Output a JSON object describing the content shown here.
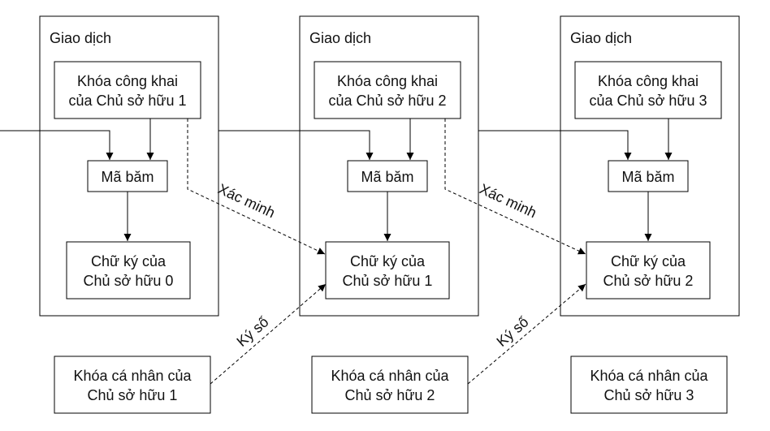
{
  "transactions": [
    {
      "title": "Giao dịch",
      "public_key": [
        "Khóa công khai",
        "của Chủ sở hữu 1"
      ],
      "hash": "Mã băm",
      "signature": [
        "Chữ ký của",
        "Chủ sở hữu 0"
      ]
    },
    {
      "title": "Giao dịch",
      "public_key": [
        "Khóa công khai",
        "của Chủ sở hữu 2"
      ],
      "hash": "Mã băm",
      "signature": [
        "Chữ ký của",
        "Chủ sở hữu 1"
      ]
    },
    {
      "title": "Giao dịch",
      "public_key": [
        "Khóa công khai",
        "của Chủ sở hữu 3"
      ],
      "hash": "Mã băm",
      "signature": [
        "Chữ ký của",
        "Chủ sở hữu 2"
      ]
    }
  ],
  "private_keys": [
    [
      "Khóa cá nhân của",
      "Chủ sở hữu 1"
    ],
    [
      "Khóa cá nhân của",
      "Chủ sở hữu 2"
    ],
    [
      "Khóa cá nhân của",
      "Chủ sở hữu 3"
    ]
  ],
  "verify_labels": [
    "Xác minh",
    "Xác minh"
  ],
  "sign_labels": [
    "Ký số",
    "Ký số"
  ]
}
